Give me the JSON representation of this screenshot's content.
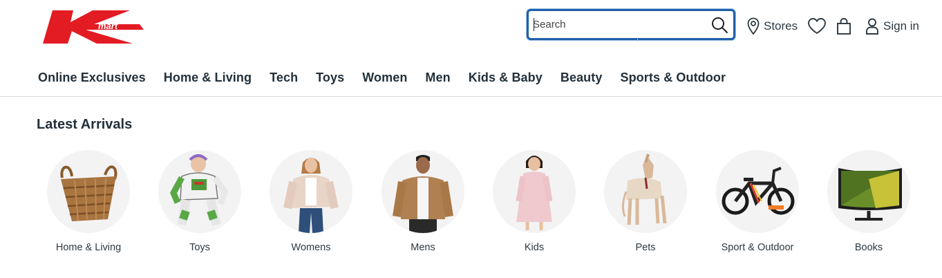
{
  "header": {
    "brand": "Kmart",
    "brand_word": "mart",
    "brand_color": "#e31b23",
    "search_placeholder": "Search",
    "stores_label": "Stores",
    "signin_label": "Sign in",
    "icons": [
      "search-icon",
      "location-pin-icon",
      "heart-icon",
      "bag-icon",
      "user-icon"
    ]
  },
  "nav": {
    "items": [
      "Online Exclusives",
      "Home & Living",
      "Tech",
      "Toys",
      "Women",
      "Men",
      "Kids & Baby",
      "Beauty",
      "Sports & Outdoor"
    ]
  },
  "latest": {
    "title": "Latest Arrivals",
    "categories": [
      "Home & Living",
      "Toys",
      "Womens",
      "Mens",
      "Kids",
      "Pets",
      "Sport & Outdoor",
      "Books"
    ]
  }
}
